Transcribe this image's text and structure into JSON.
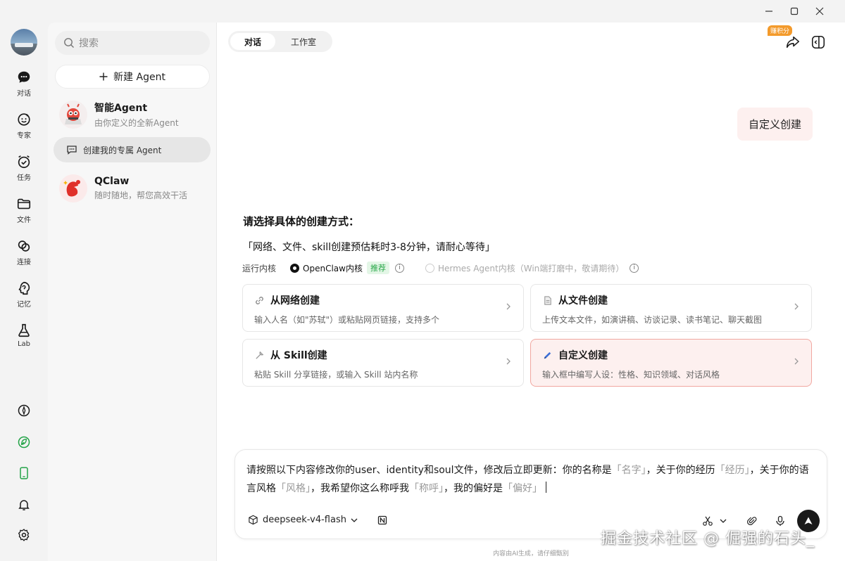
{
  "window": {
    "minimize_glyph": "—",
    "maximize_glyph": "☐",
    "close_glyph": "✕"
  },
  "rail": {
    "items": [
      {
        "label": "对话",
        "icon": "chat-icon"
      },
      {
        "label": "专家",
        "icon": "expert-icon"
      },
      {
        "label": "任务",
        "icon": "task-icon"
      },
      {
        "label": "文件",
        "icon": "folder-icon"
      },
      {
        "label": "连接",
        "icon": "link-icon"
      },
      {
        "label": "记忆",
        "icon": "memory-icon"
      },
      {
        "label": "Lab",
        "icon": "flask-icon"
      }
    ],
    "bottom_icons": [
      "compass-icon",
      "leaf-icon",
      "phone-icon",
      "bell-icon",
      "settings-icon"
    ]
  },
  "sidebar": {
    "search_placeholder": "搜索",
    "new_agent_label": "新建 Agent",
    "agents": [
      {
        "name": "智能Agent",
        "subtitle": "由你定义的全新Agent"
      },
      {
        "name": "QClaw",
        "subtitle": "随时随地，帮您高效干活"
      }
    ],
    "create_label": "创建我的专属 Agent"
  },
  "header": {
    "tabs": [
      "对话",
      "工作室"
    ],
    "active_tab": 0,
    "points_badge": "赚积分"
  },
  "chat": {
    "user_message": "自定义创建",
    "prompt_title": "请选择具体的创建方式：",
    "prompt_note": "「网络、文件、skill创建预估耗时3-8分钟，请耐心等待」",
    "kernel_label": "运行内核",
    "kernel_options": [
      {
        "label": "OpenClaw内核",
        "tag": "推荐",
        "selected": true
      },
      {
        "label": "Hermes Agent内核（Win端打磨中，敬请期待）",
        "selected": false
      }
    ],
    "cards": [
      {
        "title": "从网络创建",
        "desc": "输入人名（如\"苏轼\"）或粘贴网页链接，支持多个",
        "icon": "link-icon"
      },
      {
        "title": "从文件创建",
        "desc": "上传文本文件，如演讲稿、访谈记录、读书笔记、聊天截图",
        "icon": "document-icon"
      },
      {
        "title": "从 Skill创建",
        "desc": "粘贴 Skill 分享链接，或输入 Skill 站内名称",
        "icon": "tool-icon"
      },
      {
        "title": "自定义创建",
        "desc": "输入框中编写人设：性格、知识领域、对话风格",
        "icon": "pen-icon",
        "selected": true
      }
    ]
  },
  "composer": {
    "segments": [
      {
        "t": "请按照以下内容修改你的user、identity和soul文件，修改后立即更新：你的名称是"
      },
      {
        "t": "「名字」",
        "ph": true
      },
      {
        "t": "，关于你的经历"
      },
      {
        "t": "「经历」",
        "ph": true
      },
      {
        "t": "，关于你的语言风格"
      },
      {
        "t": "「风格」",
        "ph": true
      },
      {
        "t": "，我希望你这么称呼我"
      },
      {
        "t": "「称呼」",
        "ph": true
      },
      {
        "t": "，我的偏好是"
      },
      {
        "t": "「偏好」",
        "ph": true
      }
    ],
    "model": "deepseek-v4-flash",
    "footer_note": "内容由AI生成，请仔细甄别"
  },
  "watermark": "掘金技术社区 @ 倔强的石头_",
  "colors": {
    "accent": "#f39a2b",
    "selected_bg": "#fdf0ef",
    "selected_border": "#f1a7a0",
    "recommend_green": "#2aa84a"
  }
}
